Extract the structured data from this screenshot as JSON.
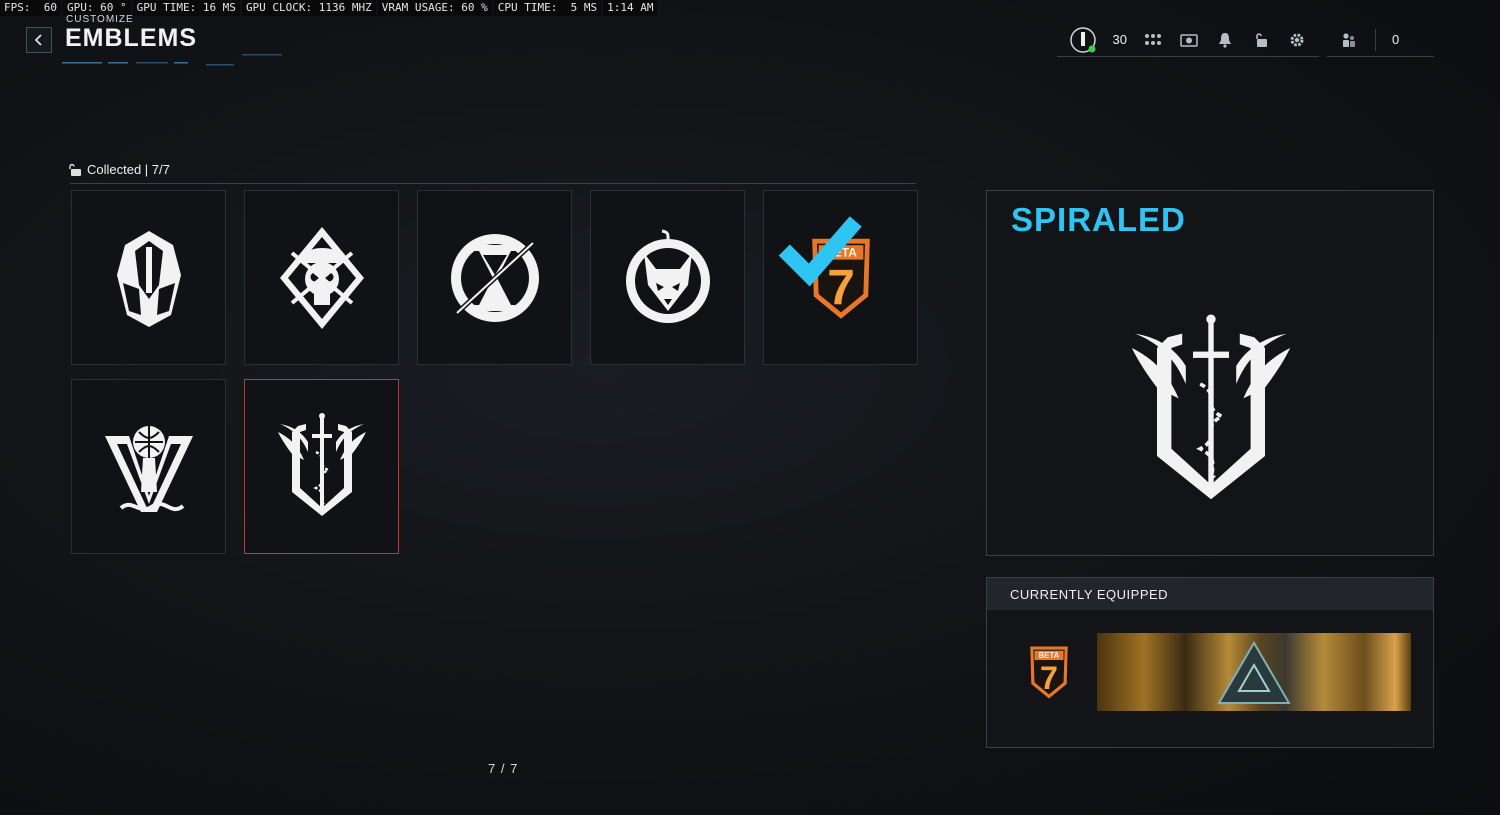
{
  "perf": {
    "fps": "FPS:  60",
    "gpu": "GPU: 60 °",
    "gpu_time": "GPU TIME: 16 MS",
    "gpu_clock": "GPU CLOCK: 1136 MHZ",
    "vram": "VRAM USAGE: 60 %",
    "cpu_time": "CPU TIME:  5 MS",
    "clock": "1:14 AM"
  },
  "header": {
    "supertitle": "CUSTOMIZE",
    "title": "EMBLEMS"
  },
  "topbar": {
    "player_count": "30",
    "friends_count": "0",
    "icons": [
      "player-status-icon",
      "apps-grid-icon",
      "camera-icon",
      "bell-icon",
      "unlock-icon",
      "gear-icon",
      "party-icon"
    ]
  },
  "collection": {
    "label": "Collected | 7/7",
    "emblems": [
      {
        "name": "Spartan Helm",
        "icon": "helmet-emblem-icon",
        "equipped": false,
        "selected": false
      },
      {
        "name": "Skull Beret",
        "icon": "skull-emblem-icon",
        "equipped": false,
        "selected": false
      },
      {
        "name": "Hourglass",
        "icon": "hourglass-emblem-icon",
        "equipped": false,
        "selected": false
      },
      {
        "name": "Wolf",
        "icon": "wolf-emblem-icon",
        "equipped": false,
        "selected": false
      },
      {
        "name": "Beta 7",
        "icon": "beta7-emblem-icon",
        "equipped": true,
        "selected": false
      },
      {
        "name": "Globe V",
        "icon": "globe-emblem-icon",
        "equipped": false,
        "selected": false
      },
      {
        "name": "Spiraled",
        "icon": "winged-sword-emblem-icon",
        "equipped": false,
        "selected": true
      }
    ]
  },
  "detail": {
    "name": "SPIRALED"
  },
  "equipped": {
    "header": "CURRENTLY EQUIPPED",
    "beta_text": "BETA",
    "beta_num": "7"
  },
  "pagination": "7 / 7",
  "colors": {
    "accent": "#2ec5f2",
    "selected_border": "#c0392b",
    "beta_orange": "#e8772a"
  }
}
